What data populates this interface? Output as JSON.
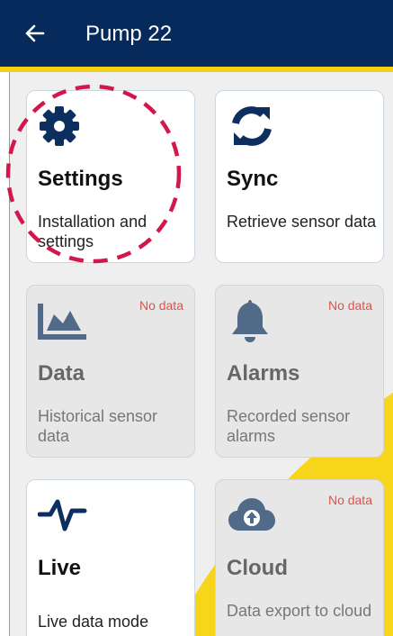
{
  "header": {
    "title": "Pump 22",
    "back_icon": "arrow-left-icon",
    "colors": {
      "bar": "#072a5c",
      "accent": "#f5cf16"
    }
  },
  "cards": [
    {
      "title": "Settings",
      "description": "Installation and settings",
      "badge": "",
      "icon": "gear-icon",
      "enabled": true
    },
    {
      "title": "Sync",
      "description": "Retrieve sensor data",
      "badge": "",
      "icon": "sync-icon",
      "enabled": true
    },
    {
      "title": "Data",
      "description": "Historical sensor data",
      "badge": "No data",
      "icon": "area-chart-icon",
      "enabled": false
    },
    {
      "title": "Alarms",
      "description": "Recorded sensor alarms",
      "badge": "No data",
      "icon": "bell-icon",
      "enabled": false
    },
    {
      "title": "Live",
      "description": "Live data mode",
      "badge": "",
      "icon": "heartbeat-icon",
      "enabled": true
    },
    {
      "title": "Cloud",
      "description": "Data export to cloud",
      "badge": "No data",
      "icon": "cloud-upload-icon",
      "enabled": false
    }
  ]
}
